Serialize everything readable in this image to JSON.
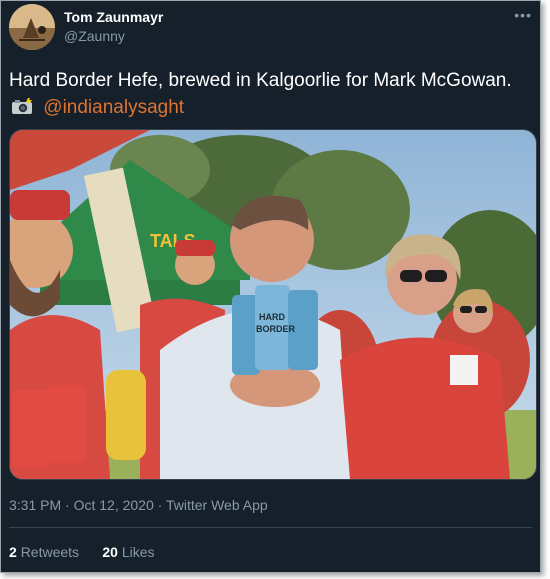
{
  "author": {
    "name": "Tom Zaunmayr",
    "handle": "@Zaunny"
  },
  "tweet": {
    "text": "Hard Border Hefe, brewed in Kalgoorlie for Mark McGowan.",
    "emoji": "camera-with-flash-icon",
    "mention": "@indianalysaght"
  },
  "meta": {
    "time": "3:31 PM",
    "date": "Oct 12, 2020",
    "source": "Twitter Web App",
    "separator": "·"
  },
  "stats": {
    "retweets_count": "2",
    "retweets_label": "Retweets",
    "likes_count": "20",
    "likes_label": "Likes"
  },
  "colors": {
    "background": "#15202b",
    "mention": "#e0732f",
    "secondary_text": "#8899a6"
  }
}
